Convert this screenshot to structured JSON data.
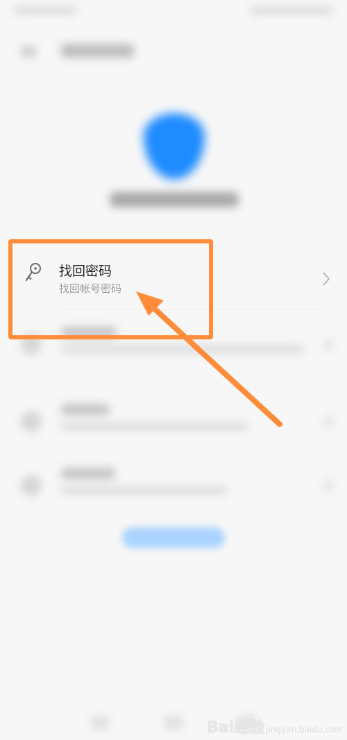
{
  "list": {
    "find_password": {
      "title": "找回密码",
      "subtitle": "找回帐号密码",
      "icon": "key-icon"
    }
  },
  "annotation": {
    "highlight_color": "#ff8c3a"
  },
  "watermark": {
    "brand": "Bai经验",
    "sub": "jingyan.baidu.com"
  }
}
